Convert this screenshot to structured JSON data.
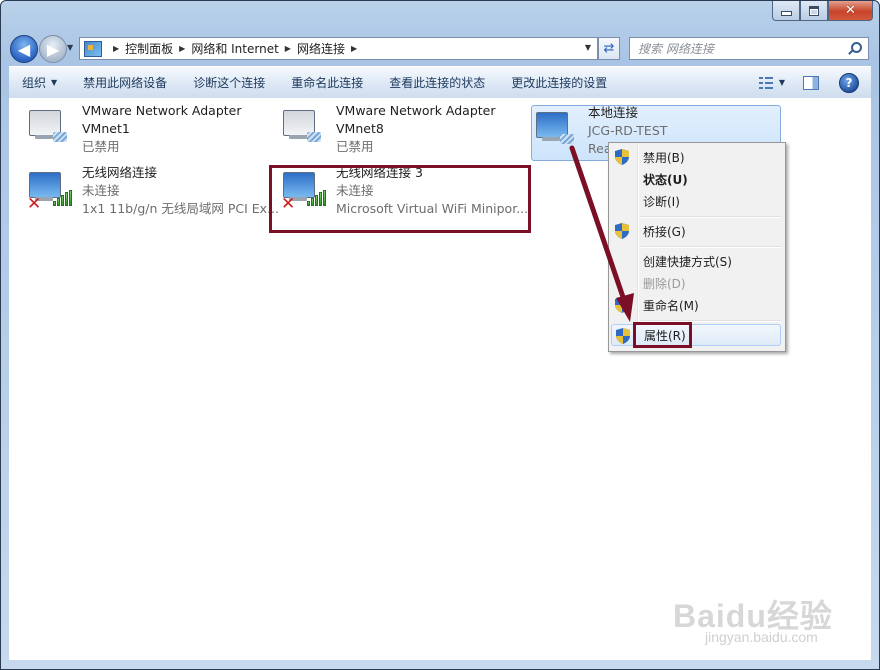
{
  "window": {
    "min_glyph": "",
    "max_glyph": "",
    "close_glyph": "✕"
  },
  "nav": {
    "back_glyph": "◀",
    "forward_glyph": "▶",
    "breadcrumbs": [
      "控制面板",
      "网络和 Internet",
      "网络连接"
    ],
    "search_placeholder": "搜索 网络连接"
  },
  "toolbar": {
    "organize": "组织",
    "commands": [
      "禁用此网络设备",
      "诊断这个连接",
      "重命名此连接",
      "查看此连接的状态",
      "更改此连接的设置"
    ]
  },
  "connections": [
    {
      "name": "VMware Network Adapter",
      "line2": "VMnet1",
      "line3": "已禁用",
      "type": "wired-disabled"
    },
    {
      "name": "VMware Network Adapter",
      "line2": "VMnet8",
      "line3": "已禁用",
      "type": "wired-disabled"
    },
    {
      "name": "本地连接",
      "line2": "JCG-RD-TEST",
      "line3": "Rea",
      "type": "wired",
      "selected": true
    },
    {
      "name": "无线网络连接",
      "line2": "未连接",
      "line3": "1x1 11b/g/n 无线局域网 PCI Ex...",
      "type": "wireless-disconnected"
    },
    {
      "name": "无线网络连接 3",
      "line2": "未连接",
      "line3": "Microsoft Virtual WiFi Minipor...",
      "type": "wireless-disconnected",
      "highlighted": true
    }
  ],
  "context_menu": {
    "items": [
      {
        "label": "禁用(B)",
        "shield": true
      },
      {
        "label": "状态(U)",
        "bold": true
      },
      {
        "label": "诊断(I)"
      },
      {
        "label": "桥接(G)",
        "shield": true
      },
      {
        "label": "创建快捷方式(S)"
      },
      {
        "label": "删除(D)",
        "disabled": true
      },
      {
        "label": "重命名(M)",
        "shield": true
      },
      {
        "label": "属性(R)",
        "shield": true,
        "hover": true,
        "highlighted": true
      }
    ]
  },
  "watermark": {
    "brand": "Baidu经验",
    "url": "jingyan.baidu.com"
  },
  "colors": {
    "annotation": "#7a0f25",
    "selection": "#cde4fb",
    "toolbar_text": "#1e395b"
  }
}
